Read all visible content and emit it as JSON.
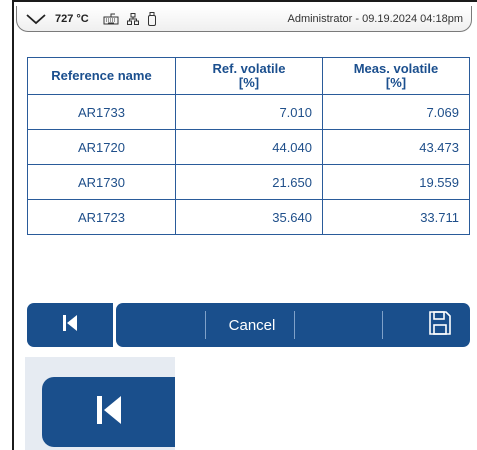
{
  "statusbar": {
    "temperature": "727 °C",
    "user_info": "Administrator - 09.19.2024 04:18pm",
    "icons": [
      "chevron-down-icon",
      "keyboard-icon",
      "network-icon",
      "usb-icon"
    ]
  },
  "table": {
    "headers": {
      "reference_name": "Reference name",
      "ref_volatile_line1": "Ref. volatile",
      "ref_volatile_line2": "[%]",
      "meas_volatile_line1": "Meas. volatile",
      "meas_volatile_line2": "[%]"
    },
    "rows": [
      {
        "name": "AR1733",
        "ref": "7.010",
        "meas": "7.069"
      },
      {
        "name": "AR1720",
        "ref": "44.040",
        "meas": "43.473"
      },
      {
        "name": "AR1730",
        "ref": "21.650",
        "meas": "19.559"
      },
      {
        "name": "AR1723",
        "ref": "35.640",
        "meas": "33.711"
      }
    ]
  },
  "buttons": {
    "back_icon": "skip-back-icon",
    "cancel_label": "Cancel",
    "save_icon": "save-icon"
  },
  "colors": {
    "primary": "#1a4f8c",
    "table_border": "#2a5b9a",
    "table_text": "#1f4f8a"
  }
}
